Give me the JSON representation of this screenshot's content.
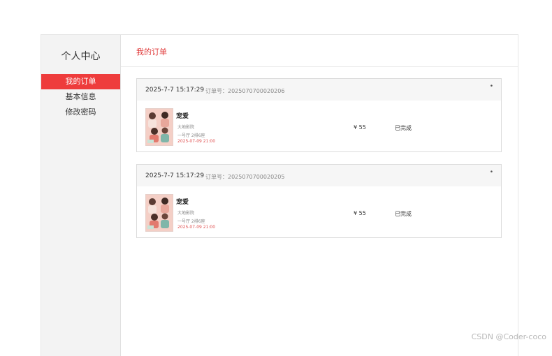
{
  "sidebar": {
    "title": "个人中心",
    "items": [
      {
        "label": "我的订单",
        "active": true
      },
      {
        "label": "基本信息",
        "active": false
      },
      {
        "label": "修改密码",
        "active": false
      }
    ]
  },
  "main": {
    "title": "我的订单"
  },
  "orders": [
    {
      "time": "2025-7-7 15:17:29",
      "order_no": "订单号：2025070700020206",
      "menu_glyph": "•",
      "movie": "宠爱",
      "cinema": "大地影院",
      "seat": "一号厅 2排6座",
      "showtime": "2025-07-09 21:00",
      "price": "¥ 55",
      "status": "已完成"
    },
    {
      "time": "2025-7-7 15:17:29",
      "order_no": "订单号：2025070700020205",
      "menu_glyph": "•",
      "movie": "宠爱",
      "cinema": "大地影院",
      "seat": "一号厅 2排6座",
      "showtime": "2025-07-09 21:00",
      "price": "¥ 55",
      "status": "已完成"
    }
  ],
  "watermark": "CSDN @Coder-coco",
  "colors": {
    "accent": "#ee3c3c",
    "sidebar_bg": "#f3f3f3",
    "order_head_bg": "#f6f6f6",
    "showtime": "#e05050"
  }
}
